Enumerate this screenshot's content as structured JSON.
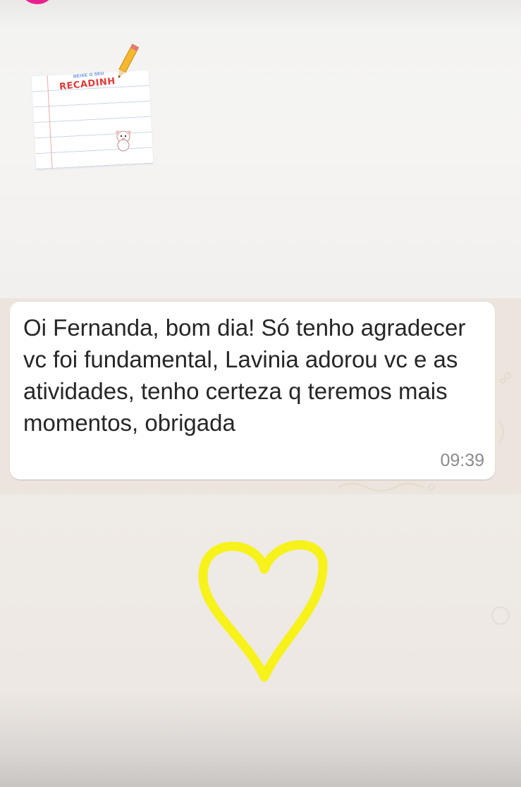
{
  "story": {
    "sticker": {
      "small_text": "DEIXE O SEU",
      "title": "RECADINH",
      "icons": [
        "notepad-icon",
        "pencil-icon",
        "critter-icon"
      ]
    },
    "message": {
      "text": "Oi Fernanda, bom dia! Só tenho agradecer vc foi fundamental, Lavinia adorou vc e as atividades, tenho certeza q teremos mais momentos, obrigada",
      "time": "09:39"
    },
    "drawing": {
      "shape": "heart-icon",
      "color": "#f7f21a"
    }
  },
  "colors": {
    "avatar_ring": "#e8208f",
    "chat_background": "#ebe5dd",
    "bubble": "#ffffff",
    "sticker_title": "#e23a3a",
    "sticker_small": "#4a7bd1"
  }
}
